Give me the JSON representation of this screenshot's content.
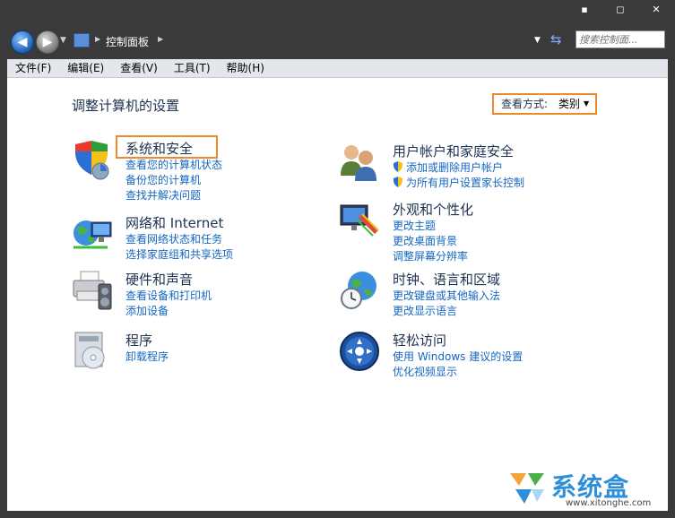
{
  "window": {
    "minimize_glyph": "▪",
    "maximize_glyph": "◻",
    "close_glyph": "✕"
  },
  "address_bar": {
    "back_glyph": "◀",
    "forward_glyph": "▶",
    "breadcrumb": "控制面板",
    "search_placeholder": "搜索控制面..."
  },
  "menu": [
    "文件(F)",
    "编辑(E)",
    "查看(V)",
    "工具(T)",
    "帮助(H)"
  ],
  "main": {
    "heading": "调整计算机的设置",
    "view_by_label": "查看方式:",
    "view_by_value": "类别"
  },
  "categories": {
    "system_security": {
      "title": "系统和安全",
      "icon": "shield-icon",
      "links": [
        "查看您的计算机状态",
        "备份您的计算机",
        "查找并解决问题"
      ]
    },
    "network": {
      "title": "网络和 Internet",
      "icon": "network-globe-icon",
      "links": [
        "查看网络状态和任务",
        "选择家庭组和共享选项"
      ]
    },
    "hardware_sound": {
      "title": "硬件和声音",
      "icon": "printer-icon",
      "links": [
        "查看设备和打印机",
        "添加设备"
      ]
    },
    "programs": {
      "title": "程序",
      "icon": "programs-disc-icon",
      "links": [
        "卸载程序"
      ]
    },
    "user_accounts": {
      "title": "用户帐户和家庭安全",
      "icon": "users-icon",
      "links": [
        "添加或删除用户帐户",
        "为所有用户设置家长控制"
      ]
    },
    "appearance": {
      "title": "外观和个性化",
      "icon": "monitor-paint-icon",
      "links": [
        "更改主题",
        "更改桌面背景",
        "调整屏幕分辨率"
      ]
    },
    "clock_region": {
      "title": "时钟、语言和区域",
      "icon": "clock-globe-icon",
      "links": [
        "更改键盘或其他输入法",
        "更改显示语言"
      ]
    },
    "ease_of_access": {
      "title": "轻松访问",
      "icon": "ease-of-access-icon",
      "links": [
        "使用 Windows 建议的设置",
        "优化视频显示"
      ]
    }
  },
  "watermark": {
    "text": "系统盒",
    "url": "www.xitonghe.com"
  }
}
